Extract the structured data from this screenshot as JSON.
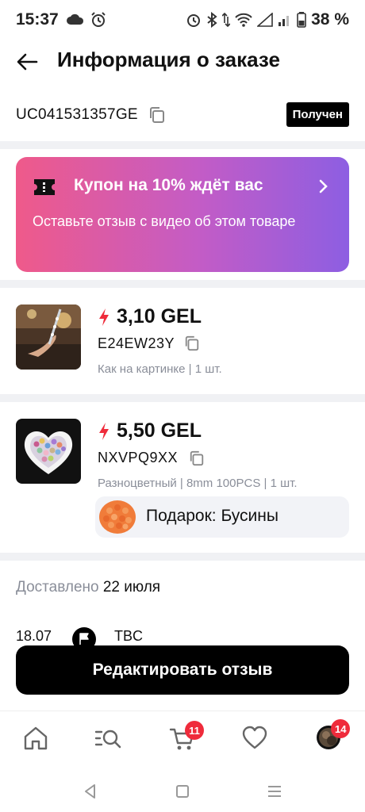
{
  "status_bar": {
    "time": "15:37",
    "battery_percent": "38 %"
  },
  "header": {
    "title": "Информация о заказе"
  },
  "order": {
    "id": "UC041531357GE",
    "status": "Получен"
  },
  "coupon": {
    "title": "Купон на 10% ждёт вас",
    "subtitle": "Оставьте отзыв с видео об этом товаре"
  },
  "products": [
    {
      "price": "3,10 GEL",
      "sku": "E24EW23Y",
      "variant": "Как на картинке | 1 шт."
    },
    {
      "price": "5,50 GEL",
      "sku": "NXVPQ9XX",
      "variant": "Разноцветный | 8mm 100PCS | 1 шт.",
      "gift": "Подарок: Бусины"
    }
  ],
  "delivery": {
    "label": "Доставлено",
    "date": "22 июля"
  },
  "tracking": {
    "date": "18.07",
    "carrier": "TBC"
  },
  "actions": {
    "primary_label": "Редактировать отзыв"
  },
  "tab_bar": {
    "cart_badge": "11",
    "account_badge": "14"
  },
  "colors": {
    "accent_red": "#ef2b3b",
    "coupon_start": "#ef5a8a",
    "coupon_end": "#8d5ee2"
  },
  "icons": [
    "home-icon",
    "search-icon",
    "cart-icon",
    "heart-icon",
    "avatar",
    "back-arrow-icon",
    "copy-icon",
    "ticket-icon",
    "chevron-right-icon",
    "lightning-icon",
    "flag-icon"
  ]
}
